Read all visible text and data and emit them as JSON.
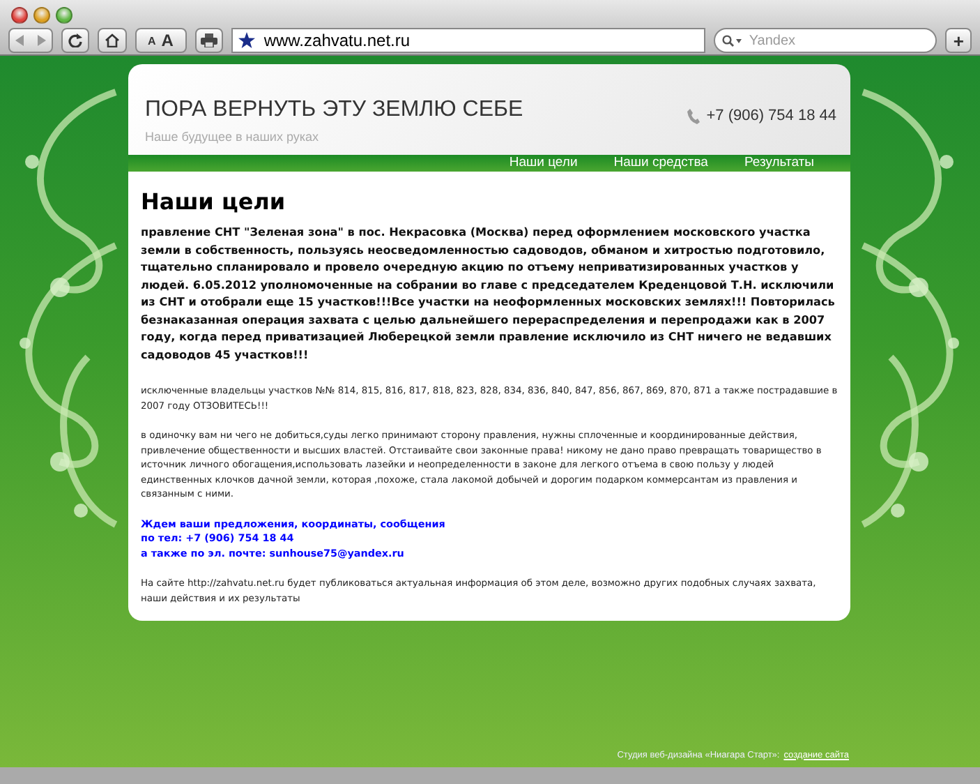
{
  "browser": {
    "url": "www.zahvatu.net.ru",
    "search": {
      "placeholder": "Yandex"
    },
    "text_small": "A",
    "text_large": "A",
    "new_tab": "+"
  },
  "header": {
    "title": "ПОРА ВЕРНУТЬ ЭТУ ЗЕМЛЮ СЕБЕ",
    "tagline": "Наше будущее в наших руках",
    "phone": "+7 (906) 754 18 44"
  },
  "nav": [
    {
      "label": "Наши цели"
    },
    {
      "label": "Наши средства"
    },
    {
      "label": "Результаты"
    }
  ],
  "content": {
    "heading": "Наши цели",
    "paragraphs": [
      {
        "kind": "lead",
        "text": "правление СНТ \"Зеленая зона\" в пос. Некрасовка (Москва) перед оформлением московского участка земли в собственность, пользуясь неосведомленностью садоводов, обманом и хитростью подготовило, тщательно спланировало и провело очередную акцию по отъему неприватизированных участков у людей. 6.05.2012 уполномоченные на собрании во главе с председателем Креденцовой Т.Н. исключили из СНТ и  отобрали еще 15 участков!!!Все участки на неоформленных московских землях!!! Повторилась безнаказанная операция захвата с целью дальнейшего перераспределения и перепродажи как в 2007  году, когда перед приватизацией Люберецкой земли правление исключило из СНТ ничего не ведавших садоводов 45 участков!!!"
      },
      {
        "kind": "small",
        "text": "исключенные владельцы участков №№ 814, 815, 816, 817, 818, 823, 828, 834, 836, 840, 847, 856, 867, 869, 870, 871 а также пострадавшие в 2007 году ОТЗОВИТЕСЬ!!!"
      },
      {
        "kind": "small",
        "text": "в одиночку вам ни чего не добиться,суды легко принимают сторону правления, нужны сплоченные и координированные действия, привлечение общественности и высших властей. Отстаивайте свои законные права! никому не дано право превращать товарищество в источник личного обогащения,использовать лазейки и неопределенности в законе для легкого  отъема в свою пользу у людей единственных клочков дачной земли, которая ,похоже, стала лакомой добычей и дорогим подарком коммерсантам из правления и связанным с ними."
      },
      {
        "kind": "contact",
        "lines": [
          "Ждем ваши предложения, координаты, сообщения",
          "по тел:    +7 (906) 754 18 44",
          "а также по эл. почте:  sunhouse75@yandex.ru"
        ]
      },
      {
        "kind": "small",
        "text": "На сайте http://zahvatu.net.ru будет публиковаться актуальная информация об этом деле, возможно других подобных случаях захвата, наши действия и их результаты"
      }
    ]
  },
  "footer": {
    "text": "Студия веб-дизайна «Ниагара Старт»:",
    "link": "создание сайта"
  }
}
